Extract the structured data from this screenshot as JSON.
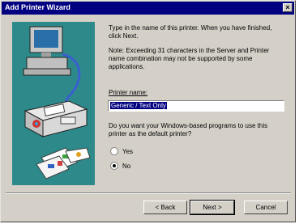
{
  "window": {
    "title": "Add Printer Wizard",
    "close_label": "×"
  },
  "content": {
    "intro": "Type in the name of this printer. When you have finished, click Next.",
    "note": "Note: Exceeding 31 characters in the Server and Printer name combination may not be supported by some applications.",
    "printer_name_label": "Printer name:",
    "printer_name_value": "Generic / Text Only",
    "default_question": "Do you want your Windows-based programs to use this printer as the default printer?",
    "options": [
      {
        "label": "Yes",
        "checked": false
      },
      {
        "label": "No",
        "checked": true
      }
    ]
  },
  "buttons": {
    "back": "< Back",
    "next": "Next >",
    "cancel": "Cancel"
  },
  "colors": {
    "titlebar": "#000080",
    "dialog": "#d4d0c8",
    "art_bg": "#2e8a8a"
  }
}
